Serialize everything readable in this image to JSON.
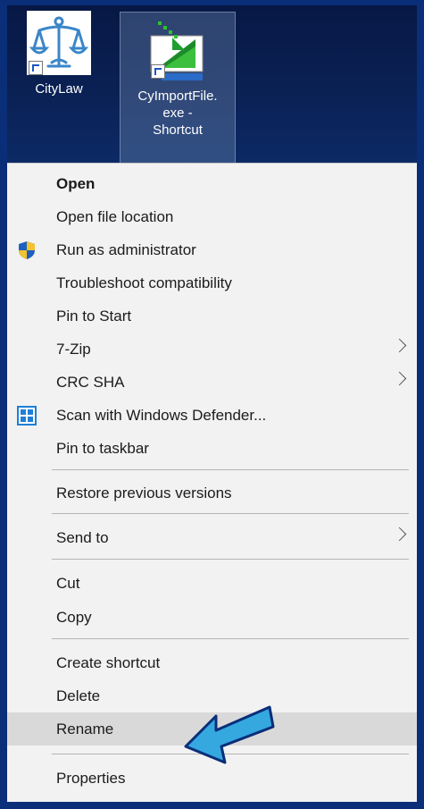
{
  "desktop": {
    "icons": [
      {
        "label": "CityLaw"
      },
      {
        "label": "CyImportFile.\nexe -\nShortcut"
      }
    ]
  },
  "menu": {
    "items": [
      {
        "label": "Open"
      },
      {
        "label": "Open file location"
      },
      {
        "label": "Run as administrator"
      },
      {
        "label": "Troubleshoot compatibility"
      },
      {
        "label": "Pin to Start"
      },
      {
        "label": "7-Zip"
      },
      {
        "label": "CRC SHA"
      },
      {
        "label": "Scan with Windows Defender..."
      },
      {
        "label": "Pin to taskbar"
      },
      {
        "label": "Restore previous versions"
      },
      {
        "label": "Send to"
      },
      {
        "label": "Cut"
      },
      {
        "label": "Copy"
      },
      {
        "label": "Create shortcut"
      },
      {
        "label": "Delete"
      },
      {
        "label": "Rename"
      },
      {
        "label": "Properties"
      }
    ]
  },
  "colors": {
    "frame": "#0a2e78",
    "menu_bg": "#f2f2f2",
    "highlight": "#d9d9d9",
    "pointer_arrow": "#35a8e0"
  }
}
